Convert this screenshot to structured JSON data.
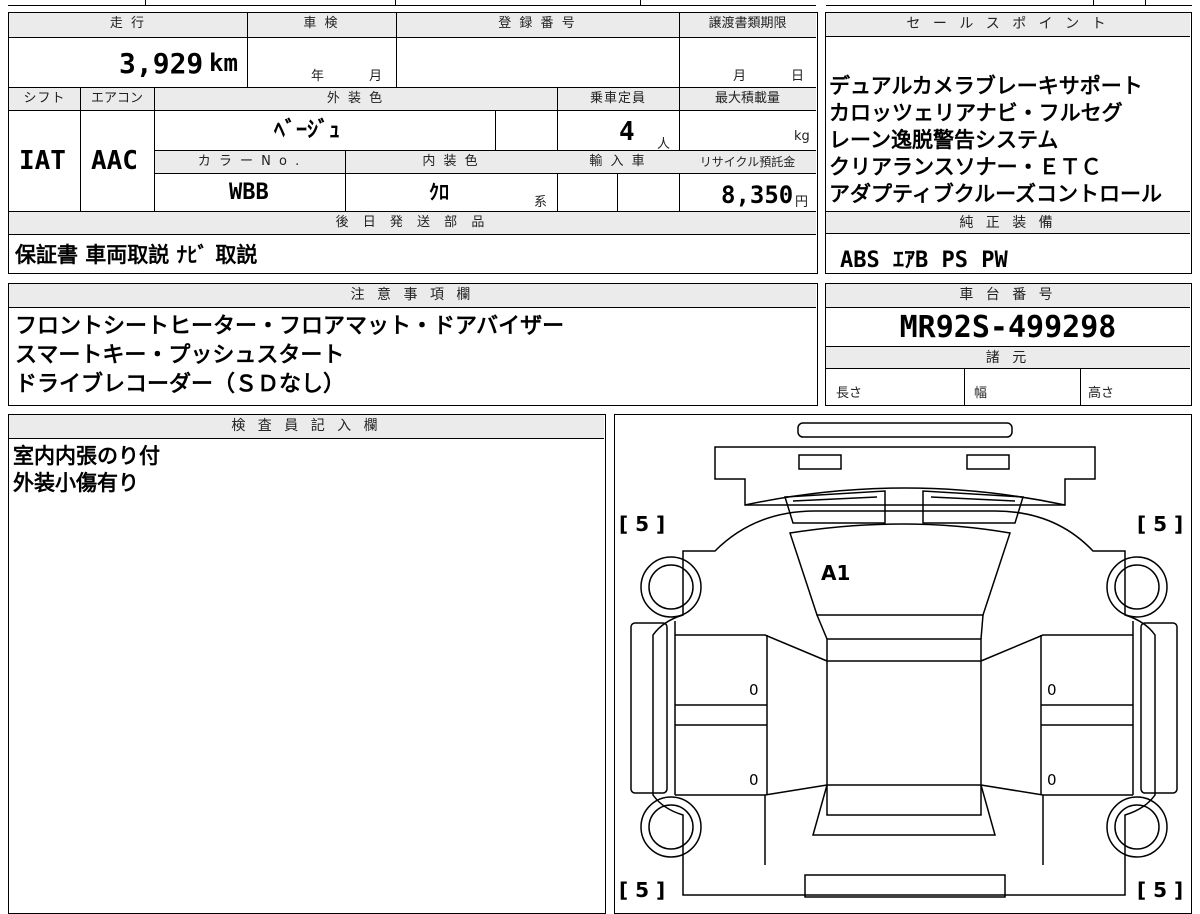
{
  "top_left": {
    "headers": {
      "mileage": "走 行",
      "inspection": "車 検",
      "registration": "登 録 番 号",
      "transfer_deadline": "譲渡書類期限",
      "shift": "シフト",
      "ac": "エアコン",
      "exterior_color": "外 装 色",
      "capacity": "乗車定員",
      "max_load": "最大積載量",
      "color_no": "カ ラ ー N o .",
      "interior_color": "内 装 色",
      "import": "輸 入 車",
      "recycle": "リサイクル預託金"
    },
    "mileage_value": "3,929",
    "mileage_unit": "km",
    "inspection_year": "年",
    "inspection_month": "月",
    "deadline_month": "月",
    "deadline_day": "日",
    "shift_value": "IAT",
    "ac_value": "AAC",
    "exterior_color_value": "ﾍﾞｰｼﾞｭ",
    "capacity_value": "4",
    "capacity_unit": "人",
    "max_load_unit": "kg",
    "color_no_value": "WBB",
    "interior_color_value": "ｸﾛ",
    "interior_color_suffix": "系",
    "recycle_value": "8,350",
    "recycle_unit": "円",
    "later_parts_header": "後 日 発 送 部 品",
    "later_parts_value": "保証書 車両取説 ﾅﾋﾞ 取説"
  },
  "sales_points": {
    "header": "セ ー ル ス ポ イ ン ト",
    "lines": [
      "デュアルカメラブレーキサポート",
      "カロッツェリアナビ・フルセグ",
      "レーン逸脱警告システム",
      "クリアランスソナー・ＥＴＣ",
      "アダプティブクルーズコントロール"
    ],
    "equipment_header": "純 正 装 備",
    "equipment_value": "ABS ｴｱB PS PW"
  },
  "notes": {
    "header": "注 意 事 項 欄",
    "lines": [
      "フロントシートヒーター・フロアマット・ドアバイザー",
      "スマートキー・プッシュスタート",
      "ドライブレコーダー（ＳＤなし）"
    ]
  },
  "chassis": {
    "header": "車 台 番 号",
    "value": "MR92S-499298",
    "specs_header": "諸 元",
    "length": "長さ",
    "width": "幅",
    "height": "高さ"
  },
  "inspector": {
    "header": "検 査 員 記 入 欄",
    "lines": [
      "室内内張のり付",
      "外装小傷有り"
    ]
  },
  "diagram": {
    "tire_top_left": "[ 5 ]",
    "tire_top_right": "[ 5 ]",
    "tire_bottom_left": "[ 5 ]",
    "tire_bottom_right": "[ 5 ]",
    "damage_mark": "A1",
    "door_left_front": "0",
    "door_left_rear": "0",
    "door_right_front": "0",
    "door_right_rear": "0"
  }
}
